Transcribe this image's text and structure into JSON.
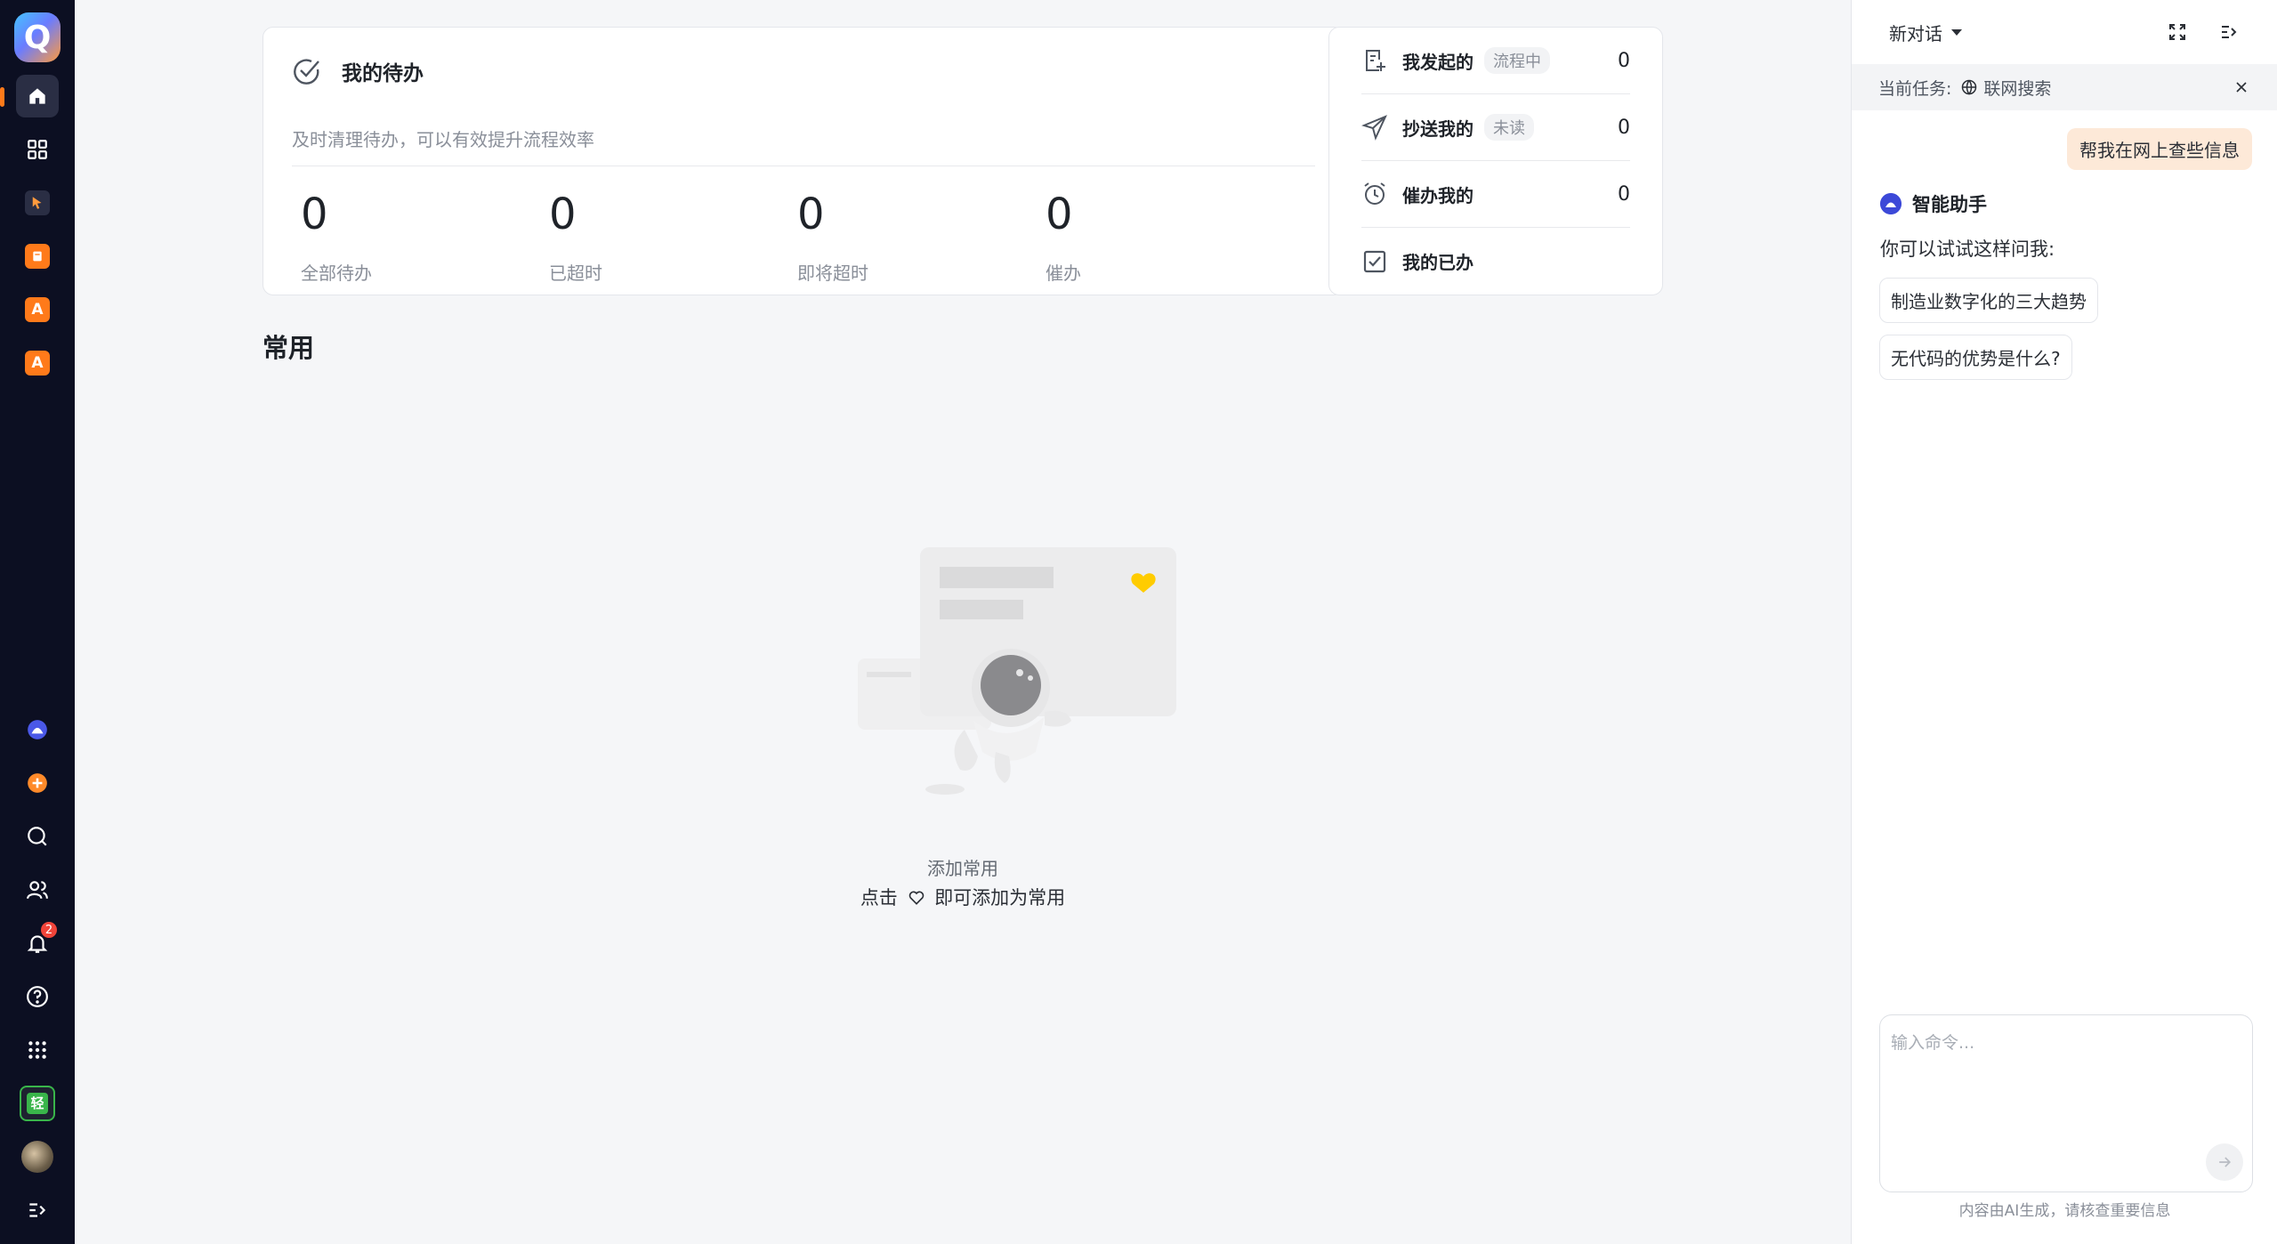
{
  "rail": {
    "logo_letter": "Q",
    "app_icons": [
      "A",
      "A"
    ],
    "notification_count": "2",
    "green_app_letter": "轻"
  },
  "todo": {
    "title": "我的待办",
    "subtitle": "及时清理待办，可以有效提升流程效率",
    "stats": [
      {
        "value": "0",
        "label": "全部待办"
      },
      {
        "value": "0",
        "label": "已超时"
      },
      {
        "value": "0",
        "label": "即将超时"
      },
      {
        "value": "0",
        "label": "催办"
      }
    ]
  },
  "flow": {
    "rows": [
      {
        "label": "我发起的",
        "tag": "流程中",
        "count": "0",
        "icon": "doc-add-icon"
      },
      {
        "label": "抄送我的",
        "tag": "未读",
        "count": "0",
        "icon": "send-icon"
      },
      {
        "label": "催办我的",
        "tag": "",
        "count": "0",
        "icon": "alarm-clock-icon"
      },
      {
        "label": "我的已办",
        "tag": "",
        "count": "",
        "icon": "checkbox-icon"
      }
    ]
  },
  "common": {
    "title": "常用",
    "empty_title": "添加常用",
    "empty_hint_prefix": "点击",
    "empty_hint_suffix": "即可添加为常用"
  },
  "panel": {
    "new_chat_label": "新对话",
    "task_label": "当前任务:",
    "task_name": "联网搜索",
    "user_message": "帮我在网上查些信息",
    "assistant_name": "智能助手",
    "try_text": "你可以试试这样问我:",
    "suggestions": [
      "制造业数字化的三大趋势",
      "无代码的优势是什么?"
    ],
    "input_placeholder": "输入命令...",
    "disclaimer": "内容由AI生成，请核查重要信息"
  },
  "colors": {
    "rail_bg": "#0c0f22",
    "accent_orange": "#ff7a1a",
    "badge_red": "#f0443a",
    "user_bubble": "#fde9d8"
  }
}
